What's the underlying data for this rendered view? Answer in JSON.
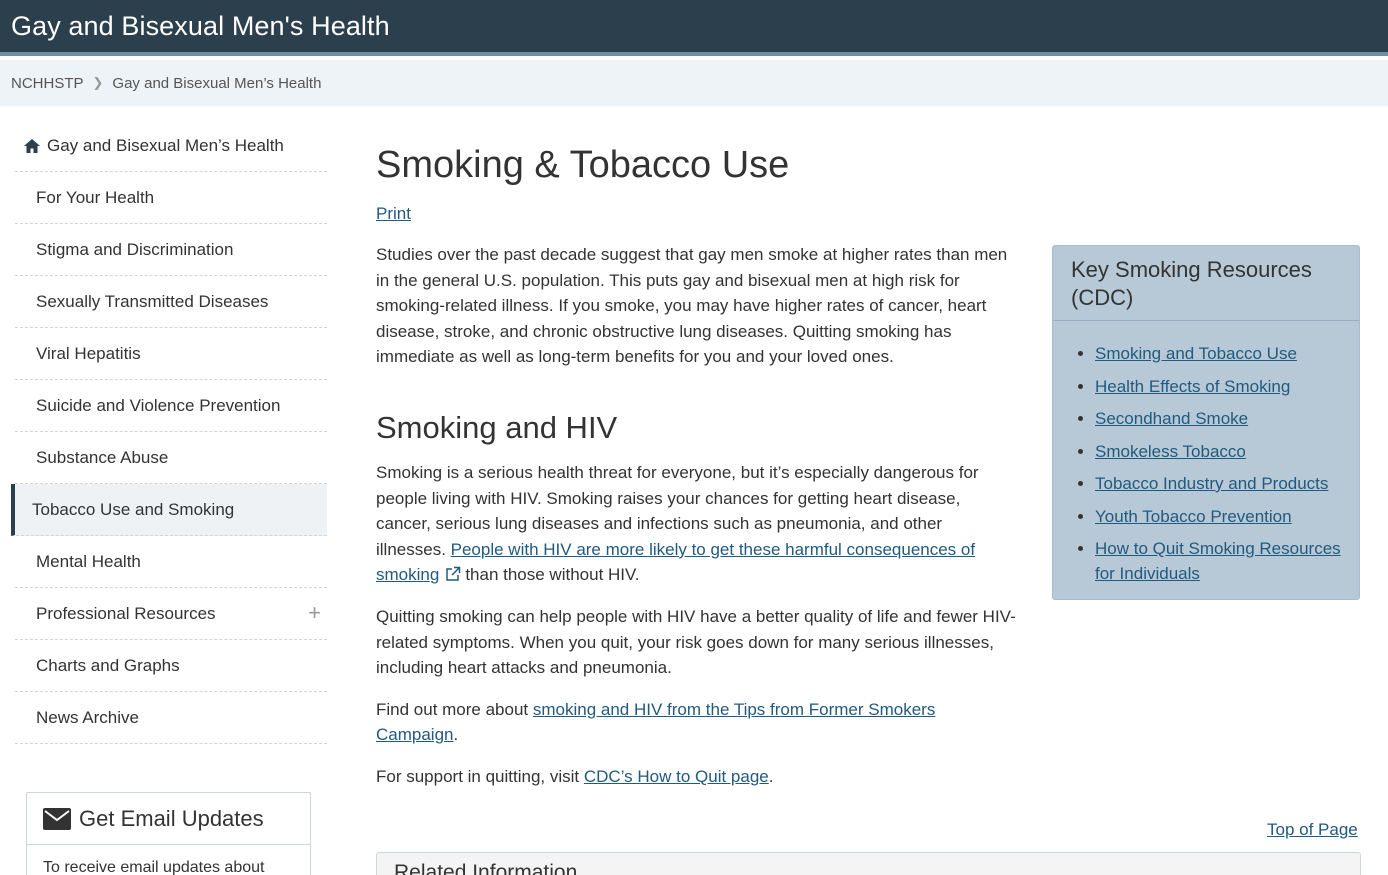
{
  "header": {
    "site_title": "Gay and Bisexual Men's Health"
  },
  "breadcrumb": {
    "items": [
      "NCHHSTP",
      "Gay and Bisexual Men’s Health"
    ]
  },
  "sidebar": {
    "home_label": "Gay and Bisexual Men’s Health",
    "items": [
      "For Your Health",
      "Stigma and Discrimination",
      "Sexually Transmitted Diseases",
      "Viral Hepatitis",
      "Suicide and Violence Prevention",
      "Substance Abuse",
      "Tobacco Use and Smoking",
      "Mental Health",
      "Professional Resources",
      "Charts and Graphs",
      "News Archive"
    ],
    "active_item": "Tobacco Use and Smoking",
    "expand_symbol": "+"
  },
  "email": {
    "title": "Get Email Updates",
    "text": "To receive email updates about"
  },
  "main": {
    "title": "Smoking & Tobacco Use",
    "print_label": "Print",
    "intro": "Studies over the past decade suggest that gay men smoke at higher rates than men in the general U.S. population. This puts gay and bisexual men at high risk for smoking-related illness. If you smoke, you may have higher rates of cancer, heart disease, stroke, and chronic obstructive lung diseases. Quitting smoking has immediate as well as long-term benefits for you and your loved ones.",
    "h2": "Smoking and HIV",
    "p1_text": "Smoking is a serious health threat for everyone, but it’s especially dangerous for people living with HIV. Smoking raises your chances for getting heart disease, cancer, serious lung diseases and infections such as pneumonia, and other illnesses. ",
    "p1_link": "People with HIV are more likely to get these harmful consequences of smoking",
    "p1_after": "than those without HIV.",
    "p2": "Quitting smoking can help people with HIV have a better quality of life and fewer HIV-related symptoms. When you quit, your risk goes down for many serious illnesses, including heart attacks and pneumonia.",
    "p3_before": "Find out more about ",
    "p3_link": "smoking and HIV from the Tips from Former Smokers Campaign",
    "p3_after": ".",
    "p4_before": "For support in quitting, visit ",
    "p4_link": "CDC’s How to Quit page",
    "p4_after": ".",
    "top_of_page": "Top of Page",
    "related_title": "Related Information"
  },
  "resources": {
    "title": "Key Smoking Resources (CDC)",
    "links": [
      "Smoking and Tobacco Use",
      "Health Effects of Smoking",
      "Secondhand Smoke",
      "Smokeless Tobacco",
      "Tobacco Industry and Products",
      "Youth Tobacco Prevention",
      "How to Quit Smoking Resources for Individuals"
    ]
  },
  "colors": {
    "header_bg": "#2b3f4d",
    "link": "#215a7f",
    "sidebar_box_bg": "#b7c9d6"
  }
}
